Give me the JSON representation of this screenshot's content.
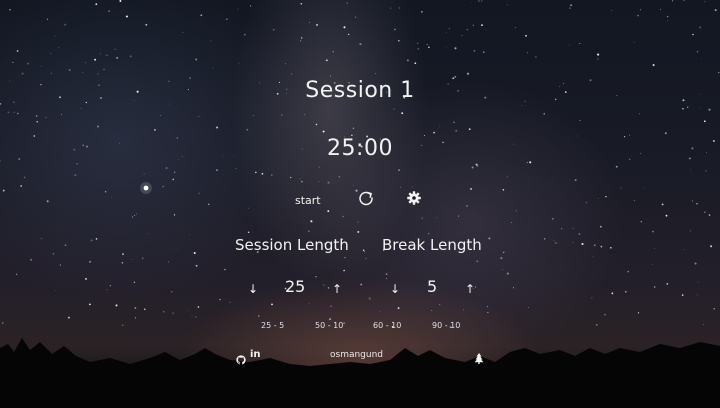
{
  "session": {
    "title": "Session 1",
    "timer": "25:00"
  },
  "controls": {
    "start_label": "start",
    "reset_icon": "refresh-icon",
    "settings_icon": "gear-icon"
  },
  "lengths": {
    "session_label": "Session Length",
    "break_label": "Break Length",
    "session_value": "25",
    "break_value": "5",
    "down_arrow": "↓",
    "up_arrow": "↑"
  },
  "presets": [
    "25 - 5",
    "50 - 10",
    "60 - 10",
    "90 - 10"
  ],
  "footer": {
    "github_icon": "github-icon",
    "linkedin_text": "in",
    "author": "osmangund",
    "tree_icon": "tree-icon"
  },
  "colors": {
    "text": "#f2f2f2",
    "sky_top": "#121722",
    "horizon": "#2b2225"
  }
}
